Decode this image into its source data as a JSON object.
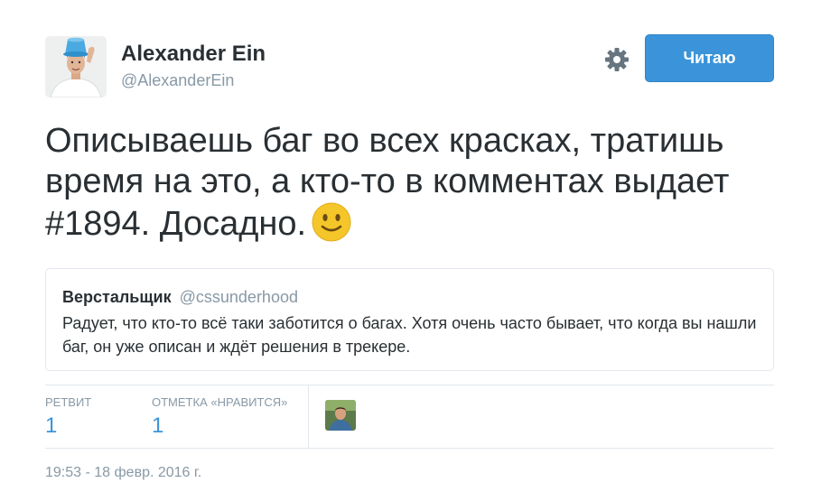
{
  "author": {
    "name": "Alexander Ein",
    "handle": "@AlexanderEin"
  },
  "header": {
    "follow_label": "Читаю",
    "gear_icon": "gear-icon"
  },
  "tweet": {
    "text": "Описываешь баг во всех красках, тратишь время на это, а кто-то в комментах выдает #1894. Досадно.",
    "emoji_icon": "slightly-smiling-face-icon"
  },
  "quote": {
    "name": "Верстальщик",
    "handle": "@cssunderhood",
    "text": "Радует, что кто-то всё таки заботится о багах. Хотя очень часто бывает, что когда вы нашли баг, он уже описан и ждёт решения в трекере."
  },
  "stats": {
    "retweets_label": "РЕТВИТ",
    "retweets_count": "1",
    "likes_label": "ОТМЕТКА «НРАВИТСЯ»",
    "likes_count": "1"
  },
  "timestamp": "19:53 - 18 февр. 2016 г.",
  "colors": {
    "accent": "#3b94d9",
    "muted": "#8899a6",
    "text": "#292f33",
    "border": "#e1e8ed"
  }
}
